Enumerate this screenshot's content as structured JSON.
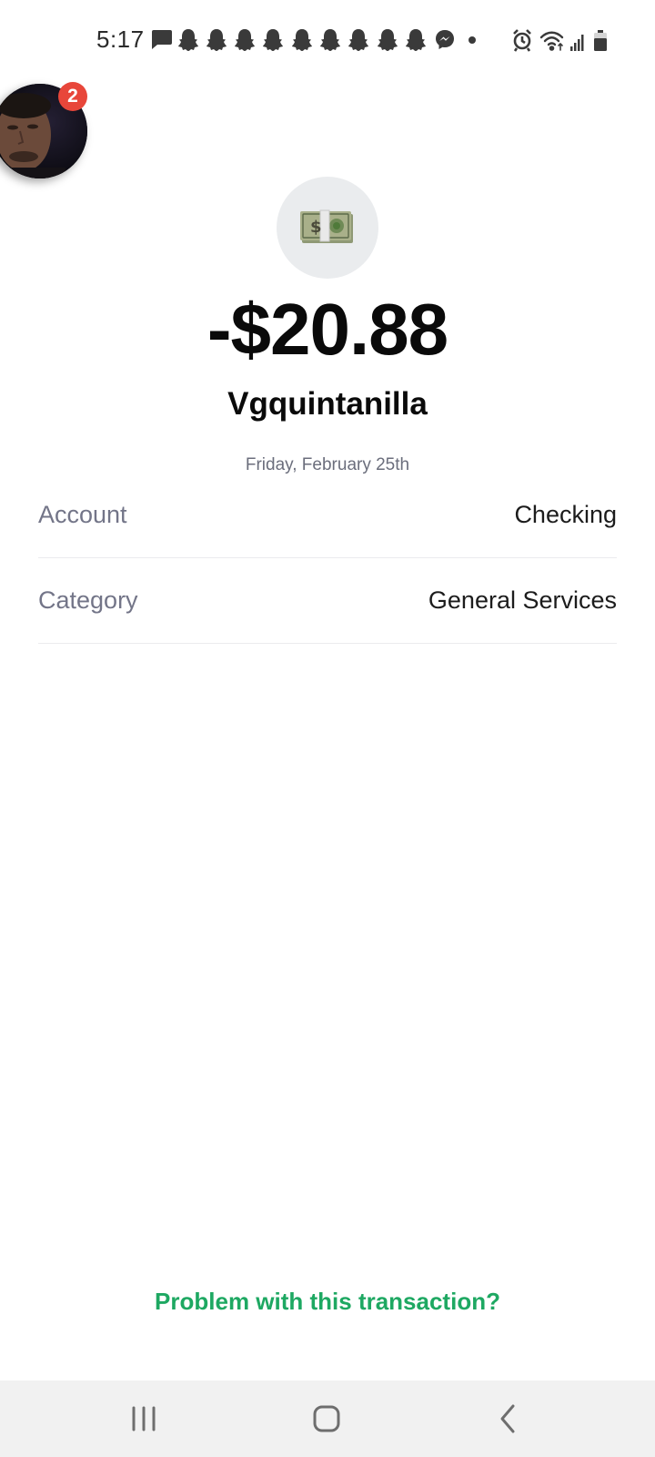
{
  "status_bar": {
    "time": "5:17",
    "notification_icons": [
      "message-icon",
      "snapchat-icon",
      "snapchat-icon",
      "snapchat-icon",
      "snapchat-icon",
      "snapchat-icon",
      "snapchat-icon",
      "snapchat-icon",
      "snapchat-icon",
      "snapchat-icon",
      "messenger-icon",
      "more-dot-icon"
    ],
    "system_icons": [
      "alarm-icon",
      "wifi-icon",
      "signal-icon",
      "battery-icon"
    ]
  },
  "chathead": {
    "badge_count": "2"
  },
  "transaction": {
    "icon": "money-icon",
    "amount": "-$20.88",
    "merchant": "Vgquintanilla",
    "date": "Friday, February 25th"
  },
  "details": [
    {
      "label": "Account",
      "value": "Checking"
    },
    {
      "label": "Category",
      "value": "General Services"
    }
  ],
  "problem_link": "Problem with this transaction?",
  "colors": {
    "accent_green": "#1ea862",
    "badge_red": "#e8463a",
    "icon_circle_bg": "#eaecee",
    "nav_bar_bg": "#f1f1f1"
  },
  "nav_bar": {
    "buttons": [
      "recents-icon",
      "home-icon",
      "back-icon"
    ]
  }
}
